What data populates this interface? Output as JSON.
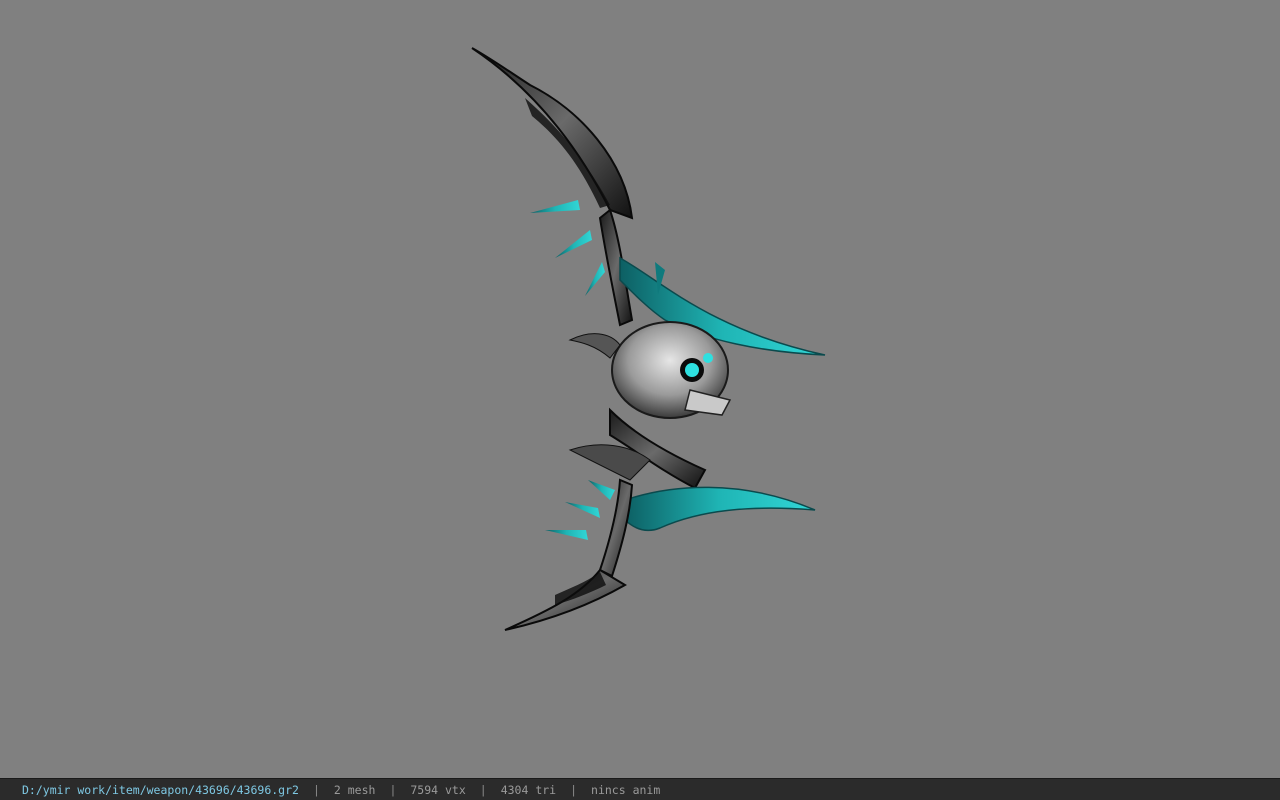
{
  "status_bar": {
    "file_path": "D:/ymir work/item/weapon/43696/43696.gr2",
    "mesh_count": "2 mesh",
    "vertex_count": "7594 vtx",
    "triangle_count": "4304 tri",
    "anim_status": "nincs anim",
    "separator": "|"
  },
  "viewport": {
    "background_color": "#808080",
    "model_icon": "skull-bow-model-icon",
    "accent_color": "#1fb5b5"
  }
}
